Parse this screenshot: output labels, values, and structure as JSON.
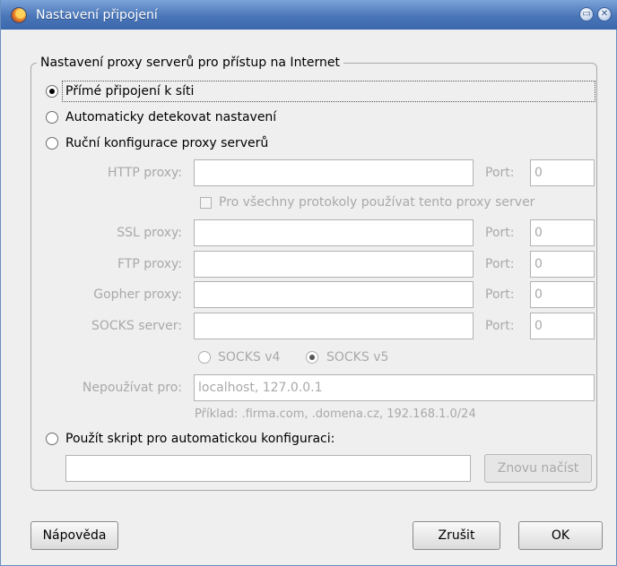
{
  "window": {
    "title": "Nastavení připojení"
  },
  "titlebar_buttons": {
    "minimize_glyph": "▭",
    "close_glyph": "✕"
  },
  "group": {
    "legend": "Nastavení proxy serverů pro přístup na Internet"
  },
  "options": {
    "direct": {
      "label": "Přímé připojení k síti",
      "selected": true
    },
    "auto_detect": {
      "label": "Automaticky detekovat nastavení",
      "selected": false
    },
    "manual": {
      "label": "Ruční konfigurace proxy serverů",
      "selected": false
    },
    "pac": {
      "label": "Použít skript pro automatickou konfiguraci:",
      "selected": false
    }
  },
  "manual": {
    "http": {
      "label": "HTTP proxy:",
      "value": "",
      "port_label": "Port:",
      "port": "0"
    },
    "same_proxy": {
      "label": "Pro všechny protokoly používat tento proxy server",
      "checked": false
    },
    "ssl": {
      "label": "SSL proxy:",
      "value": "",
      "port_label": "Port:",
      "port": "0"
    },
    "ftp": {
      "label": "FTP proxy:",
      "value": "",
      "port_label": "Port:",
      "port": "0"
    },
    "gopher": {
      "label": "Gopher proxy:",
      "value": "",
      "port_label": "Port:",
      "port": "0"
    },
    "socks": {
      "label": "SOCKS server:",
      "value": "",
      "port_label": "Port:",
      "port": "0"
    },
    "socks_v4": {
      "label": "SOCKS v4",
      "selected": false
    },
    "socks_v5": {
      "label": "SOCKS v5",
      "selected": true
    },
    "no_proxy": {
      "label": "Nepoužívat pro:",
      "value": "localhost, 127.0.0.1"
    },
    "example": "Příklad: .firma.com, .domena.cz, 192.168.1.0/24"
  },
  "pac": {
    "url": "",
    "reload_label": "Znovu načíst"
  },
  "buttons": {
    "help": "Nápověda",
    "cancel": "Zrušit",
    "ok": "OK"
  },
  "colors": {
    "titlebar": "#4a76b8",
    "dialog_bg": "#efefef",
    "disabled_text": "#a9a9a9"
  }
}
